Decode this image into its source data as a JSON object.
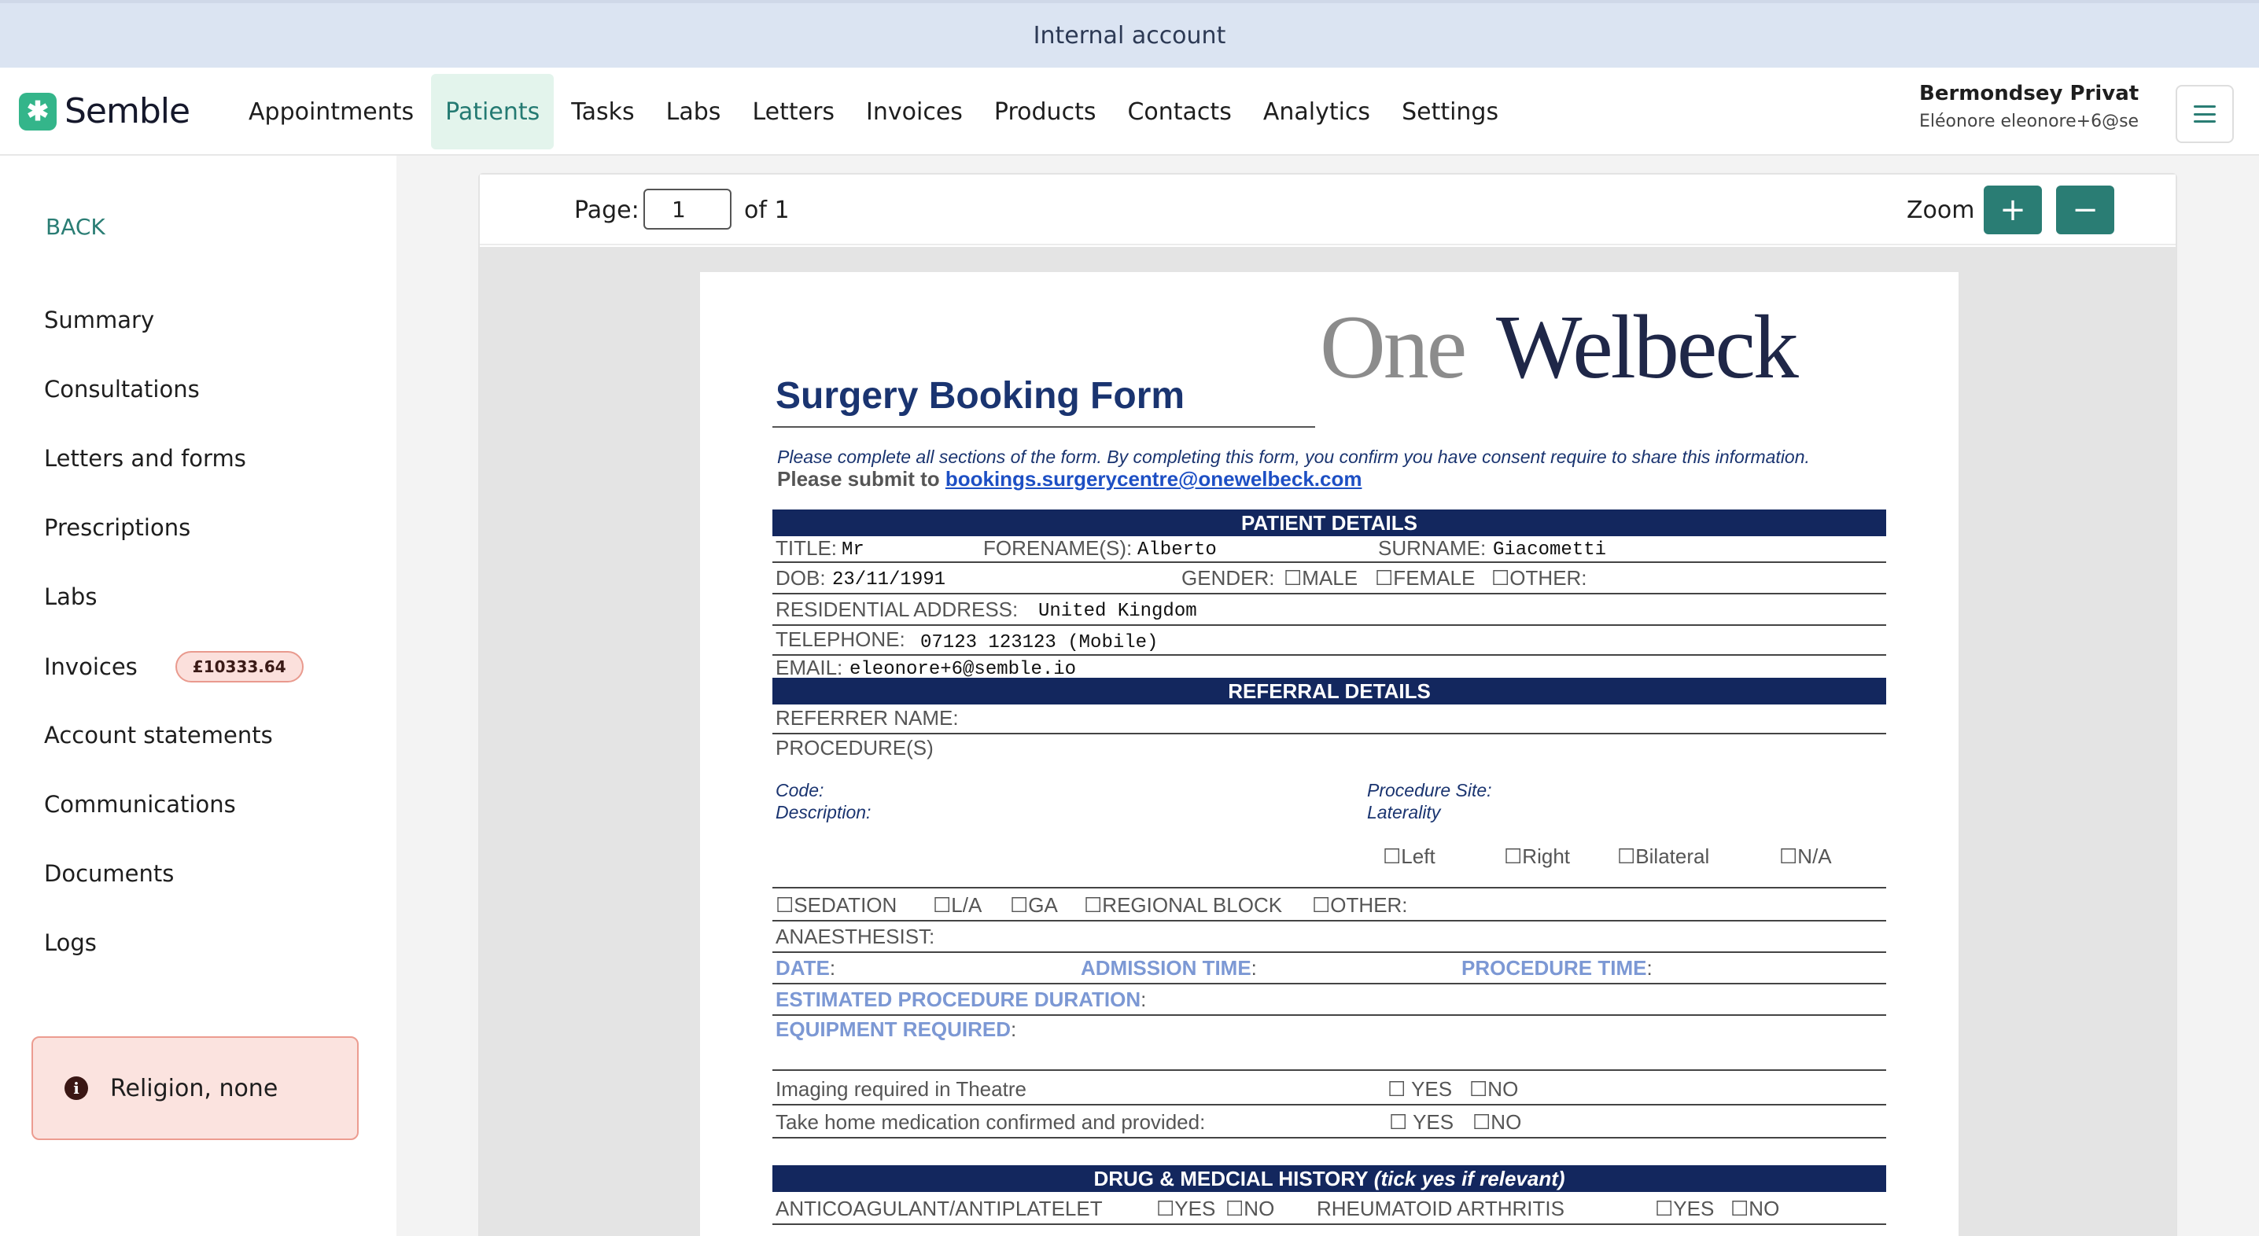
{
  "banner": {
    "text": "Internal account"
  },
  "brand": {
    "name": "Semble"
  },
  "nav": {
    "items": [
      "Appointments",
      "Patients",
      "Tasks",
      "Labs",
      "Letters",
      "Invoices",
      "Products",
      "Contacts",
      "Analytics",
      "Settings"
    ],
    "active": "Patients"
  },
  "account": {
    "org": "Bermondsey Private ...",
    "user": "Eléonore eleonore+6@se..."
  },
  "sidebar": {
    "back": "BACK",
    "items": [
      "Summary",
      "Consultations",
      "Letters and forms",
      "Prescriptions",
      "Labs",
      "Invoices",
      "Account statements",
      "Communications",
      "Documents",
      "Logs"
    ],
    "invoice_badge": "£10333.64",
    "alert": "Religion, none"
  },
  "viewer": {
    "page_label": "Page:",
    "page_value": "1",
    "page_of": "of 1",
    "zoom_label": "Zoom",
    "zoom_in": "+",
    "zoom_out": "−"
  },
  "doc": {
    "brand_one": "One",
    "brand_welbeck": "Welbeck",
    "title": "Surgery Booking Form",
    "instructions": "Please complete all sections of the form. By completing this form, you confirm you have consent require to share this information.",
    "submit_prefix": "Please submit to ",
    "submit_email": "bookings.surgerycentre@onewelbeck.com",
    "patient_header": "PATIENT DETAILS",
    "title_label": "TITLE:",
    "title_value": "Mr",
    "forename_label": "FORENAME(S):",
    "forename_value": "Alberto",
    "surname_label": "SURNAME:",
    "surname_value": "Giacometti",
    "dob_label": "DOB:",
    "dob_value": "23/11/1991",
    "gender_label": "GENDER:",
    "gender_male": "☐MALE",
    "gender_female": "☐FEMALE",
    "gender_other": "☐OTHER:",
    "address_label": "RESIDENTIAL ADDRESS:",
    "address_value": "United Kingdom",
    "telephone_label": "TELEPHONE:",
    "telephone_value": "07123 123123 (Mobile)",
    "email_label": "EMAIL:",
    "email_value": "eleonore+6@semble.io",
    "referral_header": "REFERRAL DETAILS",
    "referrer_label": "REFERRER NAME:",
    "procedures_label": "PROCEDURE(S)",
    "code_label": "Code:",
    "description_label": "Description:",
    "site_label": "Procedure Site:",
    "laterality_label": "Laterality",
    "lat_left": "☐Left",
    "lat_right": "☐Right",
    "lat_bilateral": "☐Bilateral",
    "lat_na": "☐N/A",
    "sedation": "☐SEDATION",
    "la": "☐L/A",
    "ga": "☐GA",
    "regional": "☐REGIONAL BLOCK",
    "anaes_other": "☐OTHER:",
    "anaesthesist_label": "ANAESTHESIST:",
    "date_label": "DATE",
    "admission_label": "ADMISSION TIME",
    "procedure_time_label": "PROCEDURE TIME",
    "colon": ":",
    "duration_label": "ESTIMATED PROCEDURE DURATION",
    "equipment_label": "EQUIPMENT REQUIRED",
    "imaging_label": "Imaging required in Theatre",
    "imaging_yes": "☐ YES",
    "imaging_no": "☐NO",
    "medication_label": "Take home medication confirmed and provided:",
    "medication_yes": "☐ YES",
    "medication_no": "☐NO",
    "history_header_main": "DRUG & MEDCIAL HISTORY ",
    "history_header_italic": "(tick yes if relevant)",
    "anticoag_label": "ANTICOAGULANT/ANTIPLATELET",
    "anticoag_yes": "☐YES",
    "anticoag_no": "☐NO",
    "rheum_label": "RHEUMATOID ARTHRITIS",
    "rheum_yes": "☐YES",
    "rheum_no": "☐NO"
  }
}
